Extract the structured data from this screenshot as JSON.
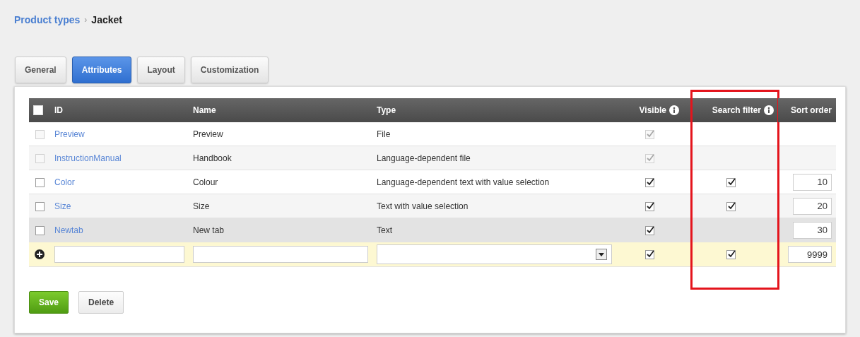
{
  "breadcrumb": {
    "parent": "Product types",
    "separator": "›",
    "current": "Jacket"
  },
  "tabs": [
    {
      "label": "General",
      "selected": false
    },
    {
      "label": "Attributes",
      "selected": true
    },
    {
      "label": "Layout",
      "selected": false
    },
    {
      "label": "Customization",
      "selected": false
    }
  ],
  "table": {
    "select_all": {
      "checked": false
    },
    "columns": [
      {
        "label": "ID",
        "info": false,
        "highlighted": false
      },
      {
        "label": "Name",
        "info": false,
        "highlighted": false
      },
      {
        "label": "Type",
        "info": false,
        "highlighted": false
      },
      {
        "label": "Visible",
        "info": true,
        "highlighted": false
      },
      {
        "label": "Search filter",
        "info": true,
        "highlighted": true
      },
      {
        "label": "Sort order",
        "info": false,
        "highlighted": false
      }
    ],
    "rows": [
      {
        "select": {
          "checked": false,
          "disabled": true
        },
        "id": "Preview",
        "name": "Preview",
        "type": "File",
        "visible": {
          "checked": true,
          "disabled": true
        },
        "hovered": false
      },
      {
        "select": {
          "checked": false,
          "disabled": true
        },
        "id": "InstructionManual",
        "name": "Handbook",
        "type": "Language-dependent file",
        "visible": {
          "checked": true,
          "disabled": true
        },
        "hovered": false
      },
      {
        "select": {
          "checked": false,
          "disabled": false
        },
        "id": "Color",
        "name": "Colour",
        "type": "Language-dependent text with value selection",
        "visible": {
          "checked": true,
          "disabled": false
        },
        "search_filter": {
          "checked": true
        },
        "sort_order": "10",
        "hovered": false
      },
      {
        "select": {
          "checked": false,
          "disabled": false
        },
        "id": "Size",
        "name": "Size",
        "type": "Text with value selection",
        "visible": {
          "checked": true,
          "disabled": false
        },
        "search_filter": {
          "checked": true
        },
        "sort_order": "20",
        "hovered": false
      },
      {
        "select": {
          "checked": false,
          "disabled": false
        },
        "id": "Newtab",
        "name": "New tab",
        "type": "Text",
        "visible": {
          "checked": true,
          "disabled": false
        },
        "sort_order": "30",
        "hovered": true
      }
    ],
    "new_row": {
      "visible": {
        "checked": true
      },
      "search_filter": {
        "checked": true
      },
      "sort_order": "9999"
    }
  },
  "buttons": [
    {
      "label": "Save",
      "kind": "primary"
    },
    {
      "label": "Delete",
      "kind": "secondary"
    }
  ]
}
